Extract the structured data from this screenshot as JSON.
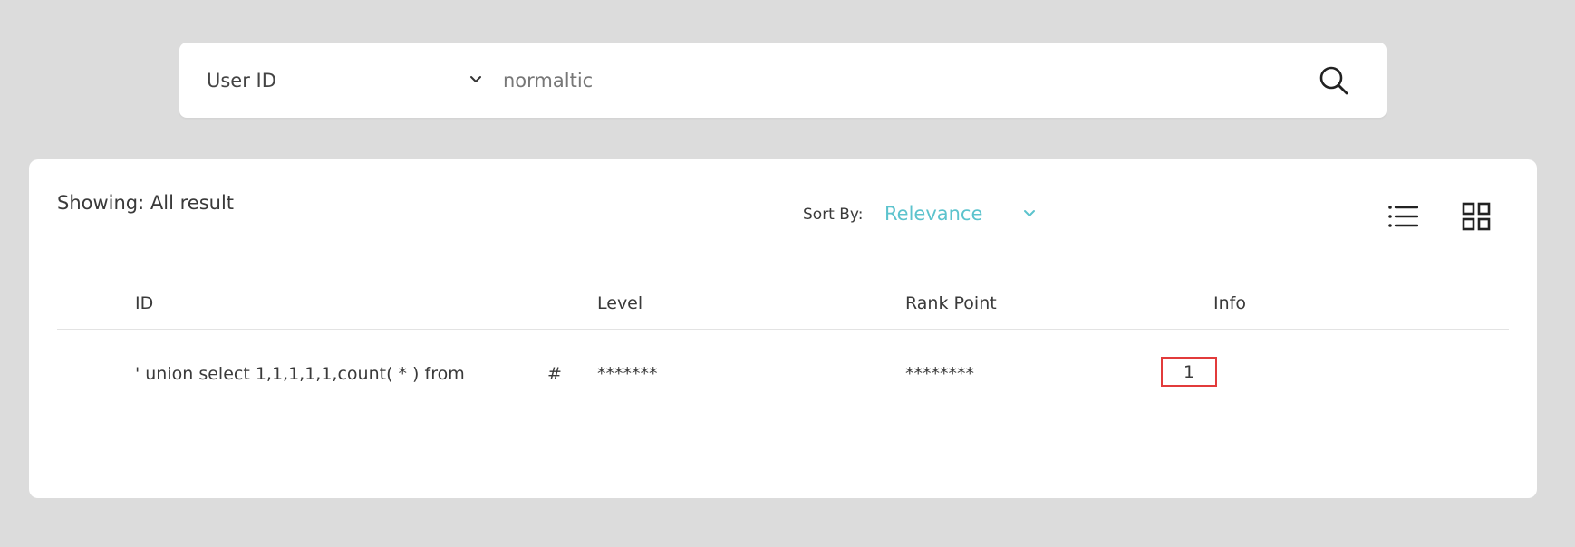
{
  "search": {
    "field_label": "User ID",
    "query": "normaltic"
  },
  "results": {
    "showing_label": "Showing: All result",
    "sort_by_label": "Sort By:",
    "sort_value": "Relevance",
    "columns": [
      "ID",
      "Level",
      "Rank Point",
      "Info"
    ],
    "rows": [
      {
        "id": "' union select 1,1,1,1,1,count( * ) from",
        "id_suffix": "#",
        "level": "*******",
        "rank_point": "********",
        "info": "1"
      }
    ]
  },
  "colors": {
    "background": "#dcdcdc",
    "accent": "#5cc3cd",
    "highlight_border": "#e23b3b"
  },
  "icons": [
    "chevron-down-icon",
    "search-icon",
    "list-view-icon",
    "grid-view-icon"
  ]
}
